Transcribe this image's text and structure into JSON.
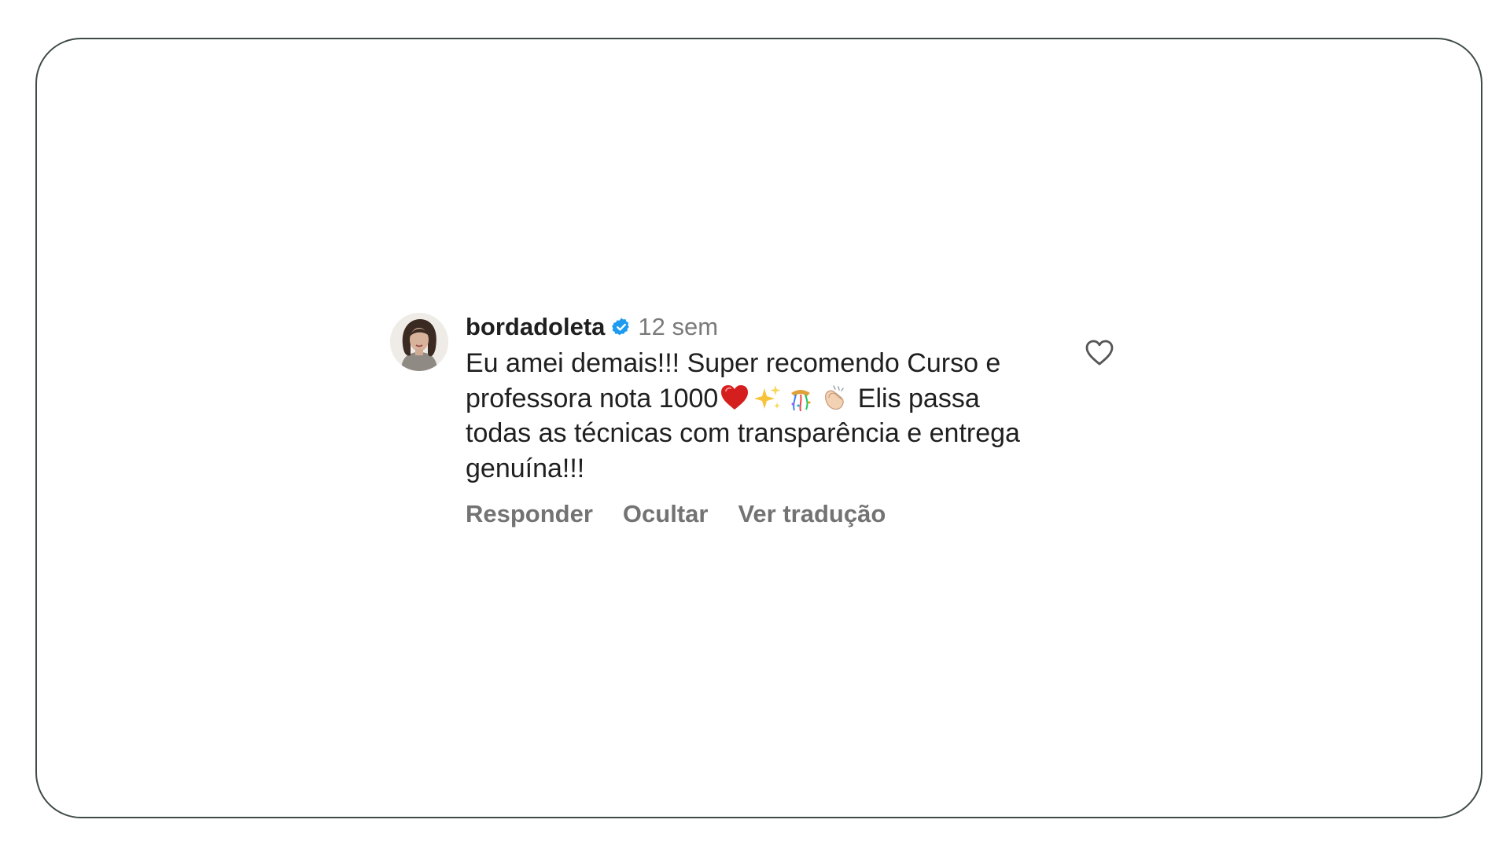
{
  "comment": {
    "username": "bordadoleta",
    "verified_icon": "verified-badge-icon",
    "timestamp": "12 sem",
    "text_part1": "Eu amei demais!!! Super recomendo Curso e professora nota 1000",
    "text_part2": " Elis passa todas as técnicas com transparência e entrega genuína!!!",
    "emojis": [
      "heart-emoji",
      "sparkles-emoji",
      "confetti-ball-emoji",
      "clapping-hands-emoji"
    ],
    "actions": {
      "reply": "Responder",
      "hide": "Ocultar",
      "translate": "Ver tradução"
    },
    "like_icon": "heart-outline-icon",
    "colors": {
      "verified": "#1d9bf0",
      "text": "#1f1f1f",
      "muted": "#737373",
      "frame_border": "#3f4b45"
    }
  }
}
